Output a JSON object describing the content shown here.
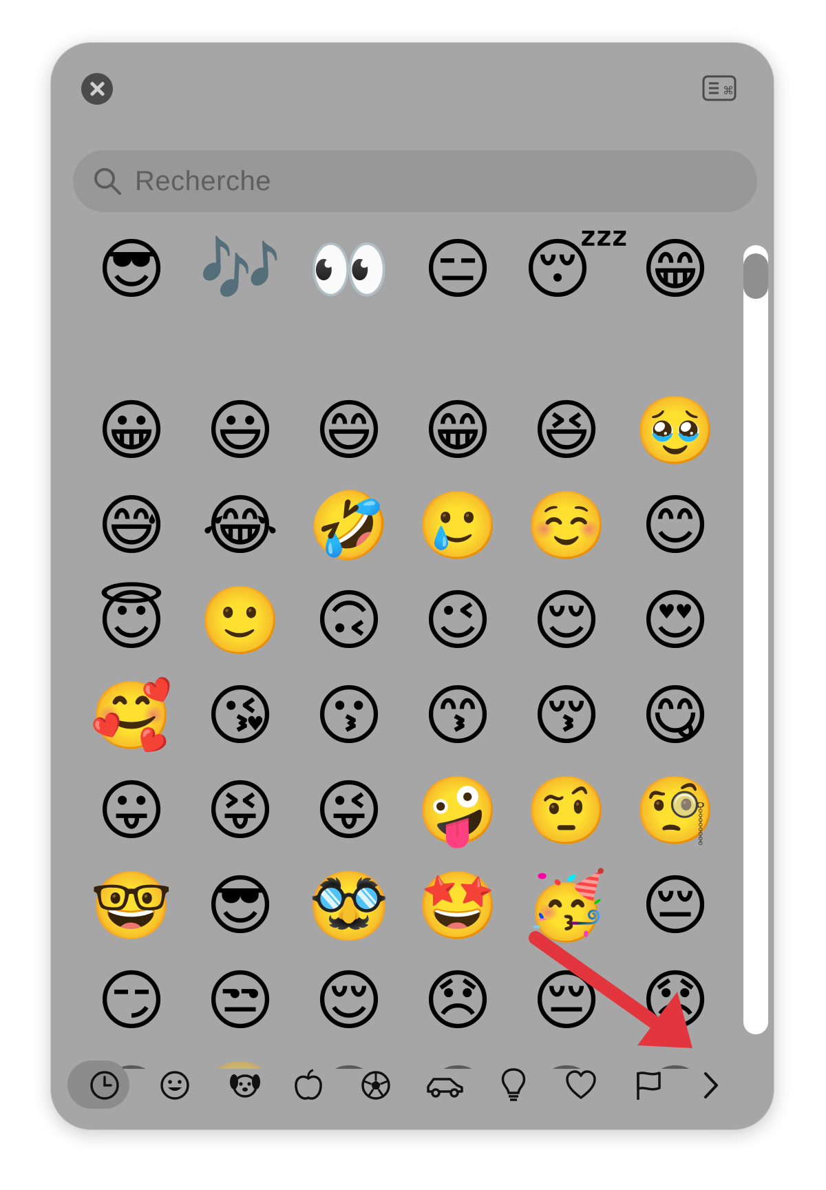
{
  "search": {
    "placeholder": "Recherche",
    "icon": "search-icon"
  },
  "header": {
    "close_icon": "close-icon",
    "keyboard_icon": "keyboard-icon"
  },
  "emoji_rows": [
    [
      "😎",
      "🎶",
      "👀",
      "😑",
      "😴",
      "😁"
    ],
    [
      "😀",
      "😃",
      "😄",
      "😁",
      "😆",
      "🥹"
    ],
    [
      "😅",
      "😂",
      "🤣",
      "🥲",
      "☺️",
      "😊"
    ],
    [
      "😇",
      "🙂",
      "🙃",
      "😉",
      "😌",
      "😍"
    ],
    [
      "🥰",
      "😘",
      "😗",
      "😙",
      "😚",
      "😋"
    ],
    [
      "😛",
      "😝",
      "😜",
      "🤪",
      "🤨",
      "🧐"
    ],
    [
      "🤓",
      "😎",
      "🥸",
      "🤩",
      "🥳",
      "😔"
    ],
    [
      "😏",
      "😒",
      "😌",
      "😞",
      "😔",
      "😟"
    ],
    [
      "😕",
      "🙁",
      "😣",
      "😖",
      "😫",
      "😩"
    ]
  ],
  "categories": [
    {
      "name": "recent",
      "icon": "clock-icon",
      "selected": true
    },
    {
      "name": "smileys",
      "icon": "smiley-icon"
    },
    {
      "name": "animals",
      "icon": "dog-icon"
    },
    {
      "name": "food",
      "icon": "apple-icon"
    },
    {
      "name": "activity",
      "icon": "soccer-ball-icon"
    },
    {
      "name": "travel",
      "icon": "car-icon"
    },
    {
      "name": "objects",
      "icon": "lightbulb-icon"
    },
    {
      "name": "symbols",
      "icon": "heart-icon"
    },
    {
      "name": "flags",
      "icon": "flag-icon"
    },
    {
      "name": "next",
      "icon": "chevron-right-icon"
    }
  ],
  "annotation": {
    "icon": "red-arrow-icon",
    "color": "#e2353d"
  },
  "colors": {
    "panel": "#a6a6a6",
    "search": "#989898",
    "selected_category": "#8c8c8c",
    "arrow": "#e2353d"
  }
}
